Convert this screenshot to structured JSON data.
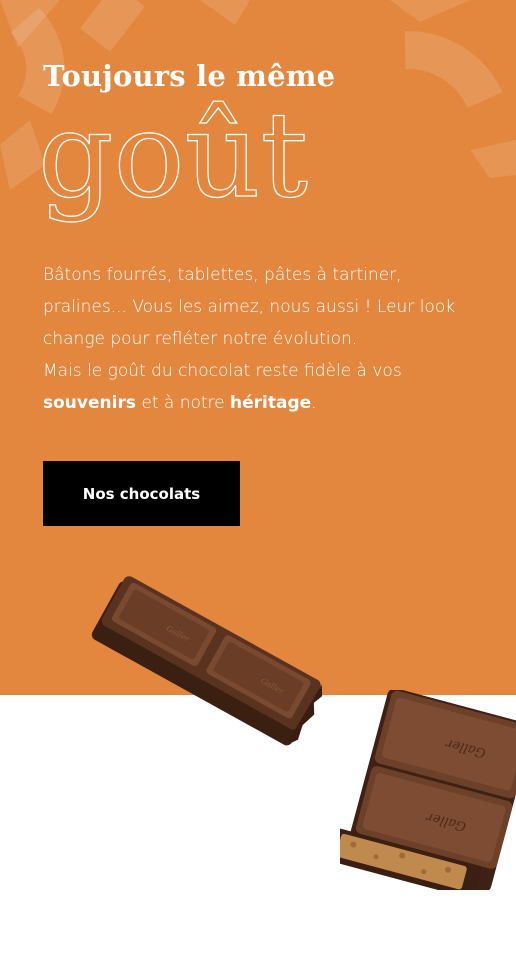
{
  "hero": {
    "kicker": "Toujours le même",
    "headline": "goût",
    "body": {
      "line1": "Bâtons fourrés, tablettes, pâtes à tartiner,",
      "line2": "pralines... Vous les aimez, nous aussi ! Leur look",
      "line3": "change pour refléter notre évolution.",
      "line4": "Mais le goût du chocolat reste fidèle à vos",
      "souvenirs": "souvenirs",
      "middle": " et à notre ",
      "heritage": "héritage",
      "end": "."
    },
    "cta_label": "Nos chocolats",
    "brand_mark": "Galler"
  },
  "colors": {
    "hero_background": "#E3873E",
    "cta_background": "#000000",
    "text": "#FFFFFF",
    "chocolate": "#4A2818"
  }
}
